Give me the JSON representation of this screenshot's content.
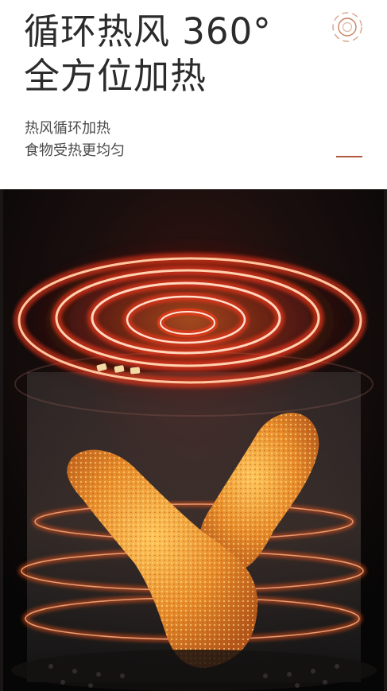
{
  "header": {
    "title_line1": "循环热风 360°",
    "title_line2": "全方位加热",
    "subtitle_line1": "热风循环加热",
    "subtitle_line2": "食物受热更均匀"
  },
  "colors": {
    "title": "#2b2b2b",
    "subtitle": "#4a4a4a",
    "accent": "#b0593d",
    "coil": "#ff3a1a",
    "heat_ring": "#ff6a2a",
    "food": "#e89632"
  },
  "icons": {
    "brand_mark": "concentric-circle-logo-icon"
  }
}
